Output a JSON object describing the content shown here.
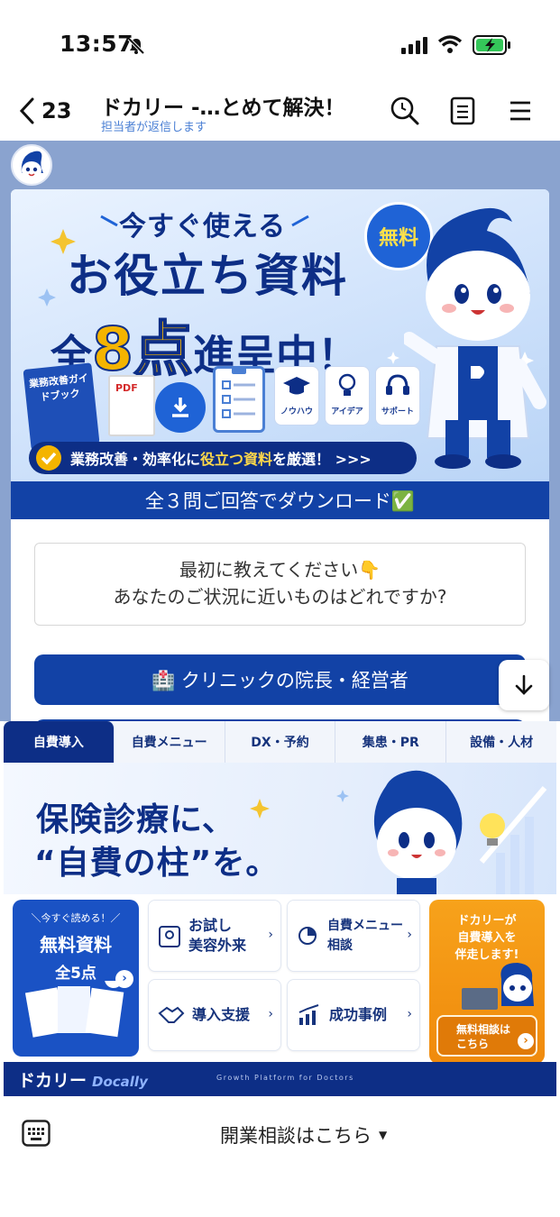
{
  "status_bar": {
    "time": "13:57"
  },
  "header": {
    "back_count": "23",
    "title": "ドカリー -…とめて解決！",
    "subtitle": "担当者が返信します"
  },
  "message": {
    "banner": {
      "line1": "今すぐ使える",
      "line2": "お役立ち資料",
      "line3_pre": "全",
      "line3_num": "8点",
      "line3_post": "進呈中！",
      "free_badge": "無料",
      "book_label": "業務改善ガイドブック",
      "pdf_label": "PDF",
      "features": [
        "ノウハウ",
        "アイデア",
        "サポート"
      ],
      "ribbon_pre": "業務改善・効率化に",
      "ribbon_hl": "役立つ資料",
      "ribbon_post": "を厳選！ >>>"
    },
    "cta": "全３問ご回答でダウンロード✅",
    "question_line1": "最初に教えてください👇",
    "question_line2": "あなたのご状況に近いものはどれですか?",
    "option1": "🏥 クリニックの院長・経営者"
  },
  "rich_menu": {
    "tabs": [
      "自費導入",
      "自費メニュー",
      "DX・予約",
      "集患・PR",
      "設備・人材"
    ],
    "active_tab": 0,
    "hero_line1": "保険診療に、",
    "hero_line2": "“自費の柱”を。",
    "left_card": {
      "l1": "＼今すぐ読める！／",
      "l2": "無料資料",
      "l3": "全5点"
    },
    "tiles": [
      {
        "label": "お試し\n美容外来"
      },
      {
        "label": "自費メニュー\n相談"
      },
      {
        "label": "導入支援"
      },
      {
        "label": "成功事例"
      }
    ],
    "right_card": {
      "text": "ドカリーが\n自費導入を\n伴走します!",
      "button": "無料相談は\nこちら"
    },
    "footer_logo": "ドカリー",
    "footer_logo_en": "Docally",
    "footer_tagline": "Growth Platform for Doctors"
  },
  "bottom_bar": {
    "menu_label": "開業相談はこちら"
  },
  "colors": {
    "navy": "#0d2e86",
    "blue": "#1242a6",
    "orange": "#f08a0c",
    "chat_bg": "#8aa3cf"
  }
}
